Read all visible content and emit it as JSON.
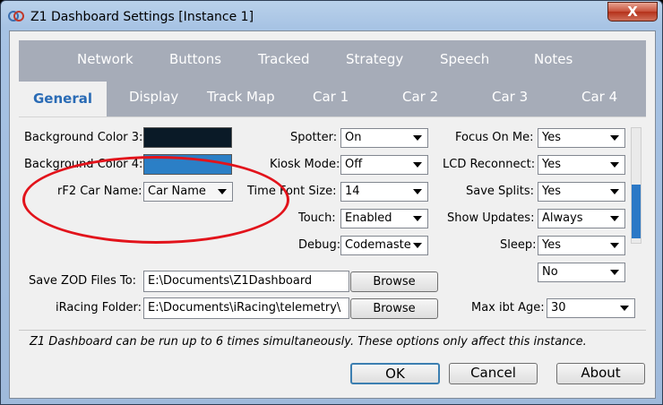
{
  "window": {
    "title": "Z1 Dashboard Settings [Instance 1]",
    "close_label": "X"
  },
  "tabs_row1": [
    "Network",
    "Buttons",
    "Tracked",
    "Strategy",
    "Speech",
    "Notes"
  ],
  "tabs_row2": [
    "General",
    "Display",
    "Track Map",
    "Car 1",
    "Car 2",
    "Car 3",
    "Car 4"
  ],
  "active_tab": "General",
  "left": {
    "bg3_label": "Background Color 3:",
    "bg3_color": "#0a1a27",
    "bg4_label": "Background Color 4:",
    "bg4_color": "#2b7fc6",
    "rf2_label": "rF2 Car Name:",
    "rf2_value": "Car Name"
  },
  "middle": [
    {
      "label": "Spotter:",
      "value": "On"
    },
    {
      "label": "Kiosk Mode:",
      "value": "Off"
    },
    {
      "label": "Time Font Size:",
      "value": "14"
    },
    {
      "label": "Touch:",
      "value": "Enabled"
    },
    {
      "label": "Debug:",
      "value": "Codemaste"
    }
  ],
  "right": [
    {
      "label": "Focus On Me:",
      "value": "Yes"
    },
    {
      "label": "LCD Reconnect:",
      "value": "Yes"
    },
    {
      "label": "Save Splits:",
      "value": "Yes"
    },
    {
      "label": "Show Updates:",
      "value": "Always"
    },
    {
      "label": "Sleep:",
      "value": "Yes"
    },
    {
      "label": "",
      "value": "No"
    }
  ],
  "paths": {
    "zod_label": "Save ZOD Files To:",
    "zod_value": "E:\\Documents\\Z1Dashboard",
    "iracing_label": "iRacing Folder:",
    "iracing_value": "E:\\Documents\\iRacing\\telemetry\\",
    "browse_label": "Browse"
  },
  "ibt": {
    "label": "Max ibt Age:",
    "value": "30"
  },
  "footer_note": "Z1 Dashboard can be run up to 6 times simultaneously. These options only affect this instance.",
  "buttons": {
    "ok": "OK",
    "cancel": "Cancel",
    "about": "About"
  },
  "accent_color": "#2a6bb5",
  "annotation_color": "#e2131b"
}
